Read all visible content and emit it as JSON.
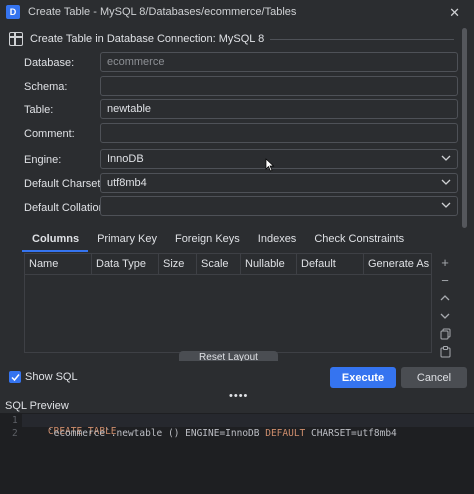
{
  "window": {
    "title": "Create Table - MySQL 8/Databases/ecommerce/Tables",
    "close_glyph": "✕"
  },
  "header": {
    "text": "Create Table in Database Connection: MySQL 8"
  },
  "form": {
    "database_label": "Database:",
    "database_value": "ecommerce",
    "schema_label": "Schema:",
    "schema_value": "",
    "table_label": "Table:",
    "table_value": "newtable",
    "comment_label": "Comment:",
    "comment_value": "",
    "engine_label": "Engine:",
    "engine_value": "InnoDB",
    "charset_label": "Default Charset:",
    "charset_value": "utf8mb4",
    "collation_label": "Default Collation:",
    "collation_value": ""
  },
  "tabs": [
    "Columns",
    "Primary Key",
    "Foreign Keys",
    "Indexes",
    "Check Constraints"
  ],
  "grid": {
    "columns": [
      "Name",
      "Data Type",
      "Size",
      "Scale",
      "Nullable",
      "Default",
      "Generate As"
    ]
  },
  "tools": {
    "add": "+",
    "remove": "−",
    "up": "⌃",
    "down": "⌄"
  },
  "hidden_button": "Reset Layout",
  "footer": {
    "show_sql_label": "Show SQL",
    "show_sql_checked": true,
    "execute_label": "Execute",
    "cancel_label": "Cancel"
  },
  "splitter": "••••",
  "sql_preview": {
    "label": "SQL Preview",
    "line_numbers": [
      "1",
      "2"
    ],
    "line1_keyword": "CREATE TABLE",
    "line2_pre": "    `ecommerce`.newtable () ENGINE=InnoDB ",
    "line2_kw": "DEFAULT",
    "line2_post": " CHARSET=utf8mb4"
  },
  "colors": {
    "accent": "#3574f0",
    "background": "#2b2d30",
    "editor_bg": "#1e1f22",
    "keyword": "#cf8e6d"
  }
}
